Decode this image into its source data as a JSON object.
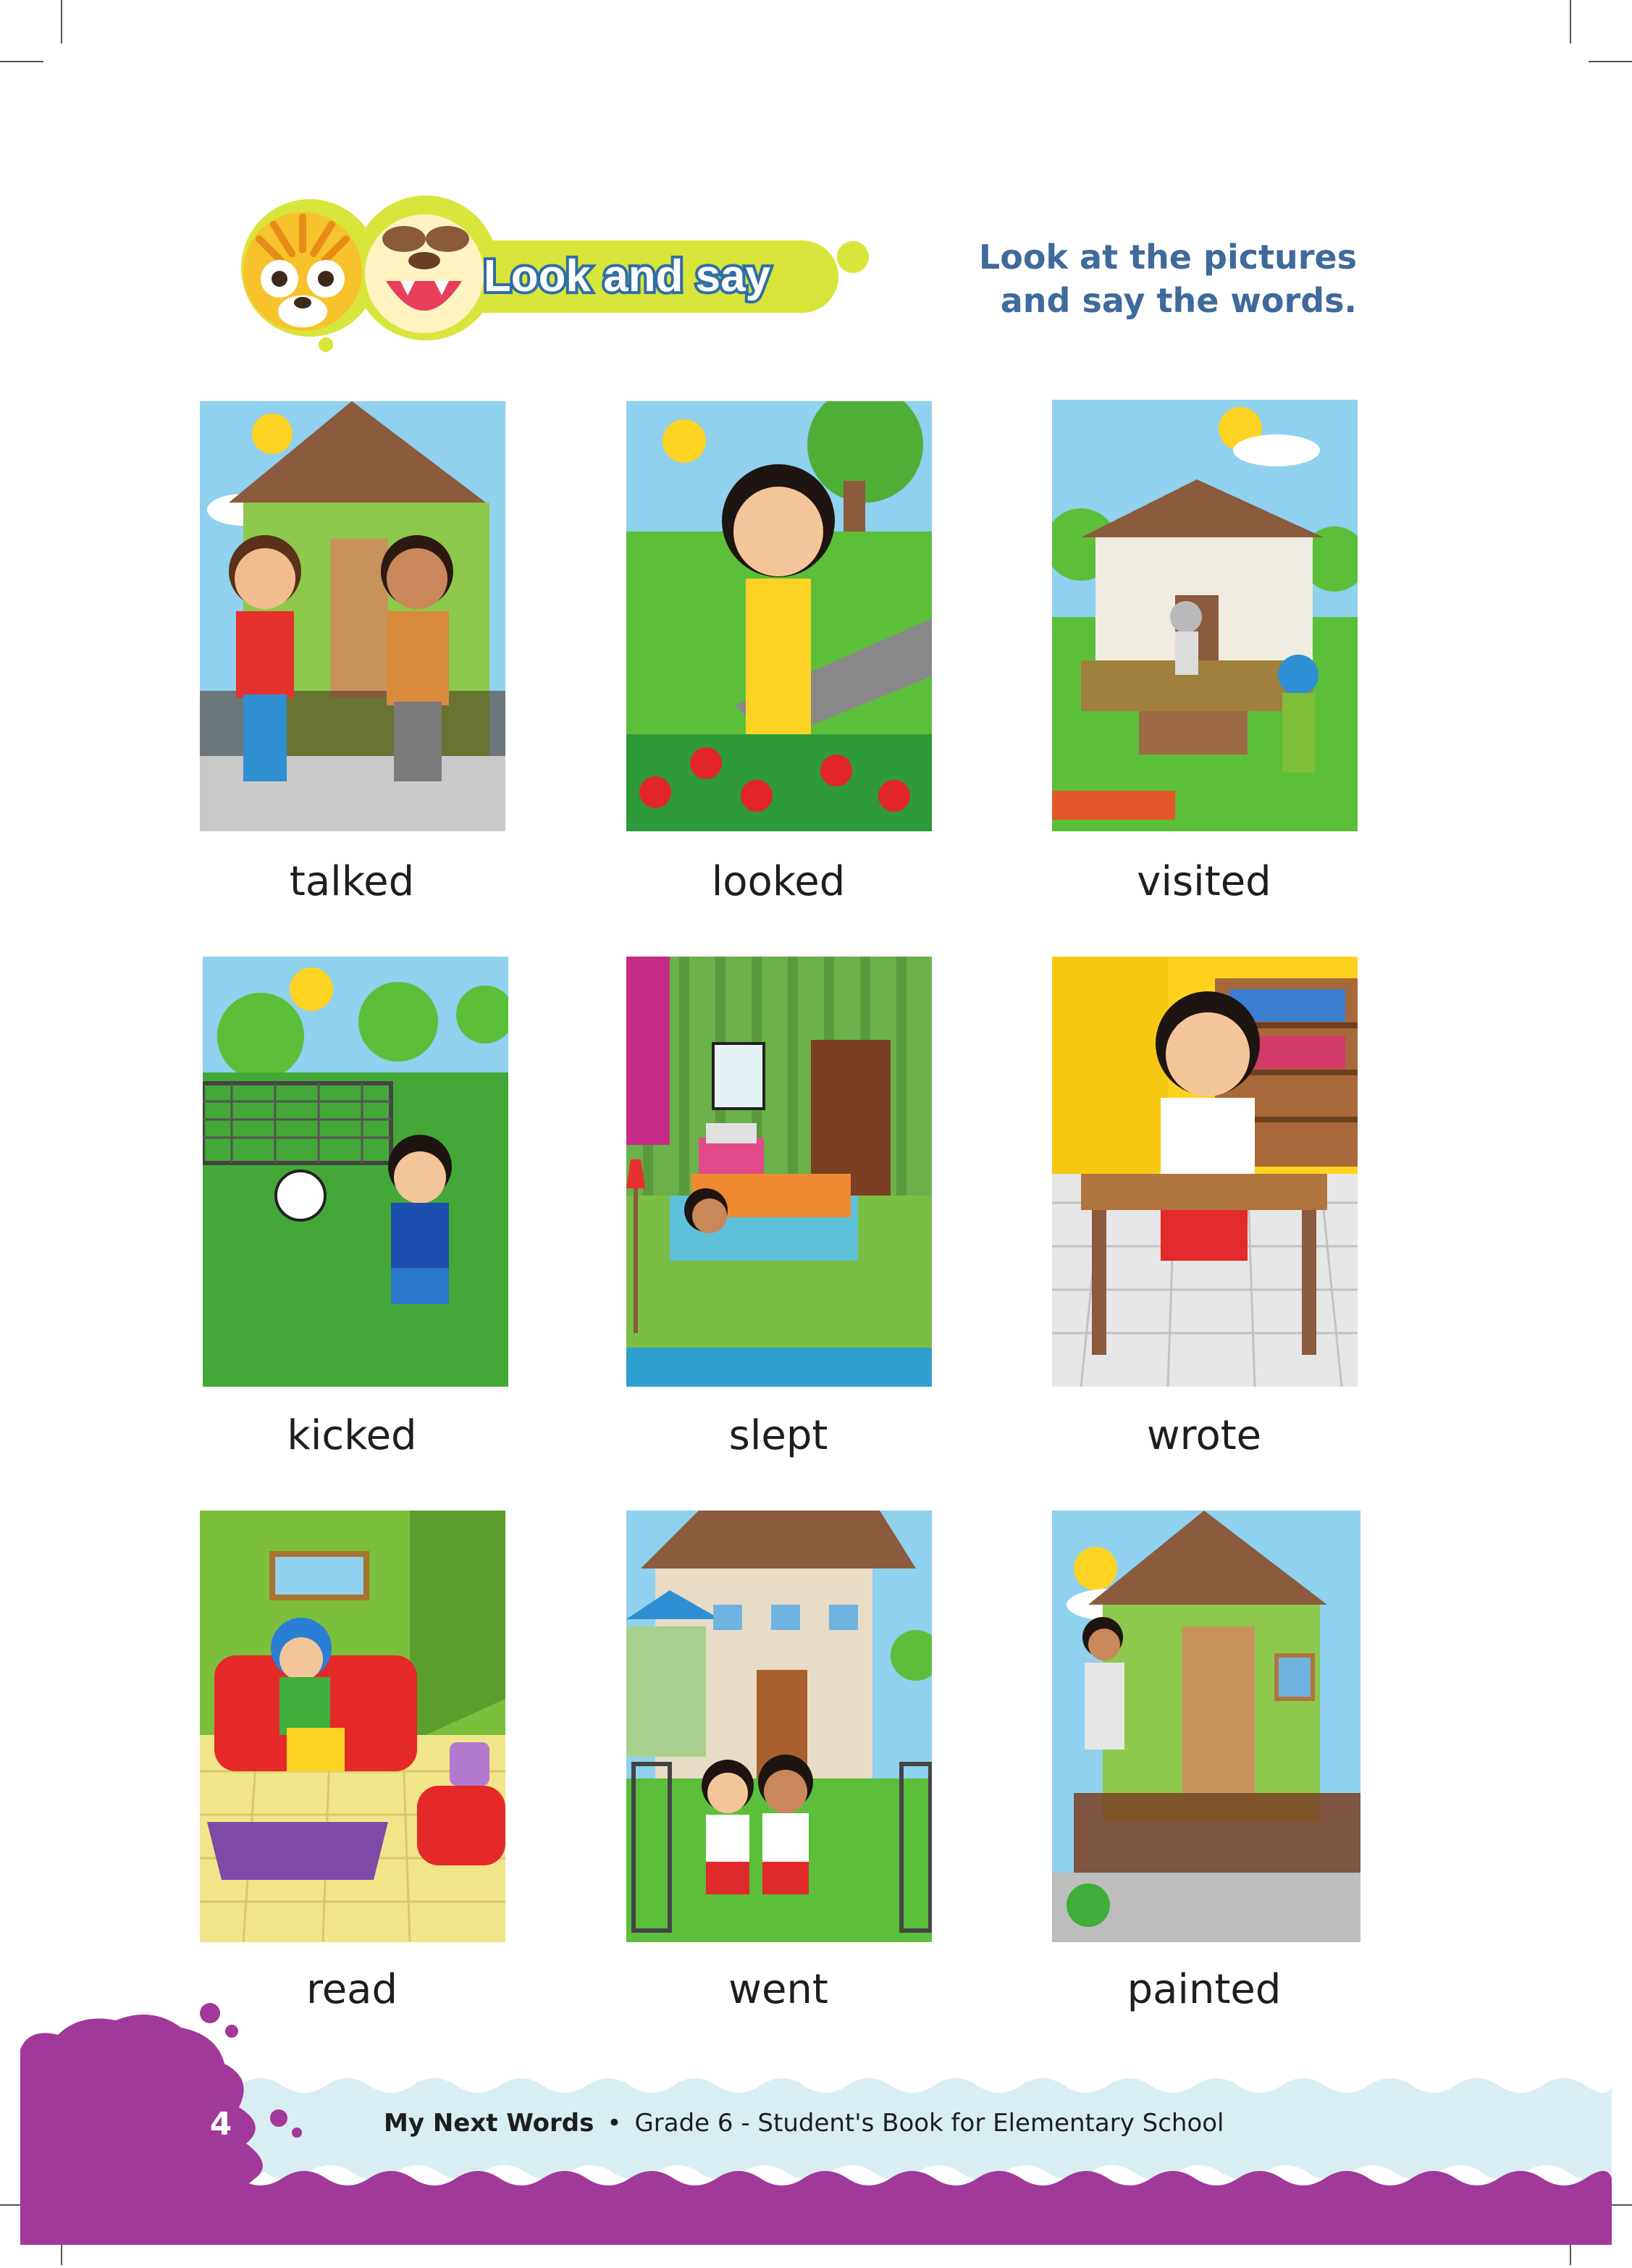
{
  "header": {
    "badge_title": "Look and say",
    "instruction_line1": "Look at the pictures",
    "instruction_line2": "and say the words."
  },
  "words": [
    "talked",
    "looked",
    "visited",
    "kicked",
    "slept",
    "wrote",
    "read",
    "went",
    "painted"
  ],
  "footer": {
    "page_number": "4",
    "book_title": "My Next Words",
    "separator": "•",
    "subtitle": "Grade 6 - Student's Book for Elementary School"
  },
  "colors": {
    "accent_purple": "#a0399a",
    "wave_light_blue": "#d9eef2",
    "badge_yellow_green": "#d8e53a",
    "instruction_blue": "#3f6a9b"
  }
}
